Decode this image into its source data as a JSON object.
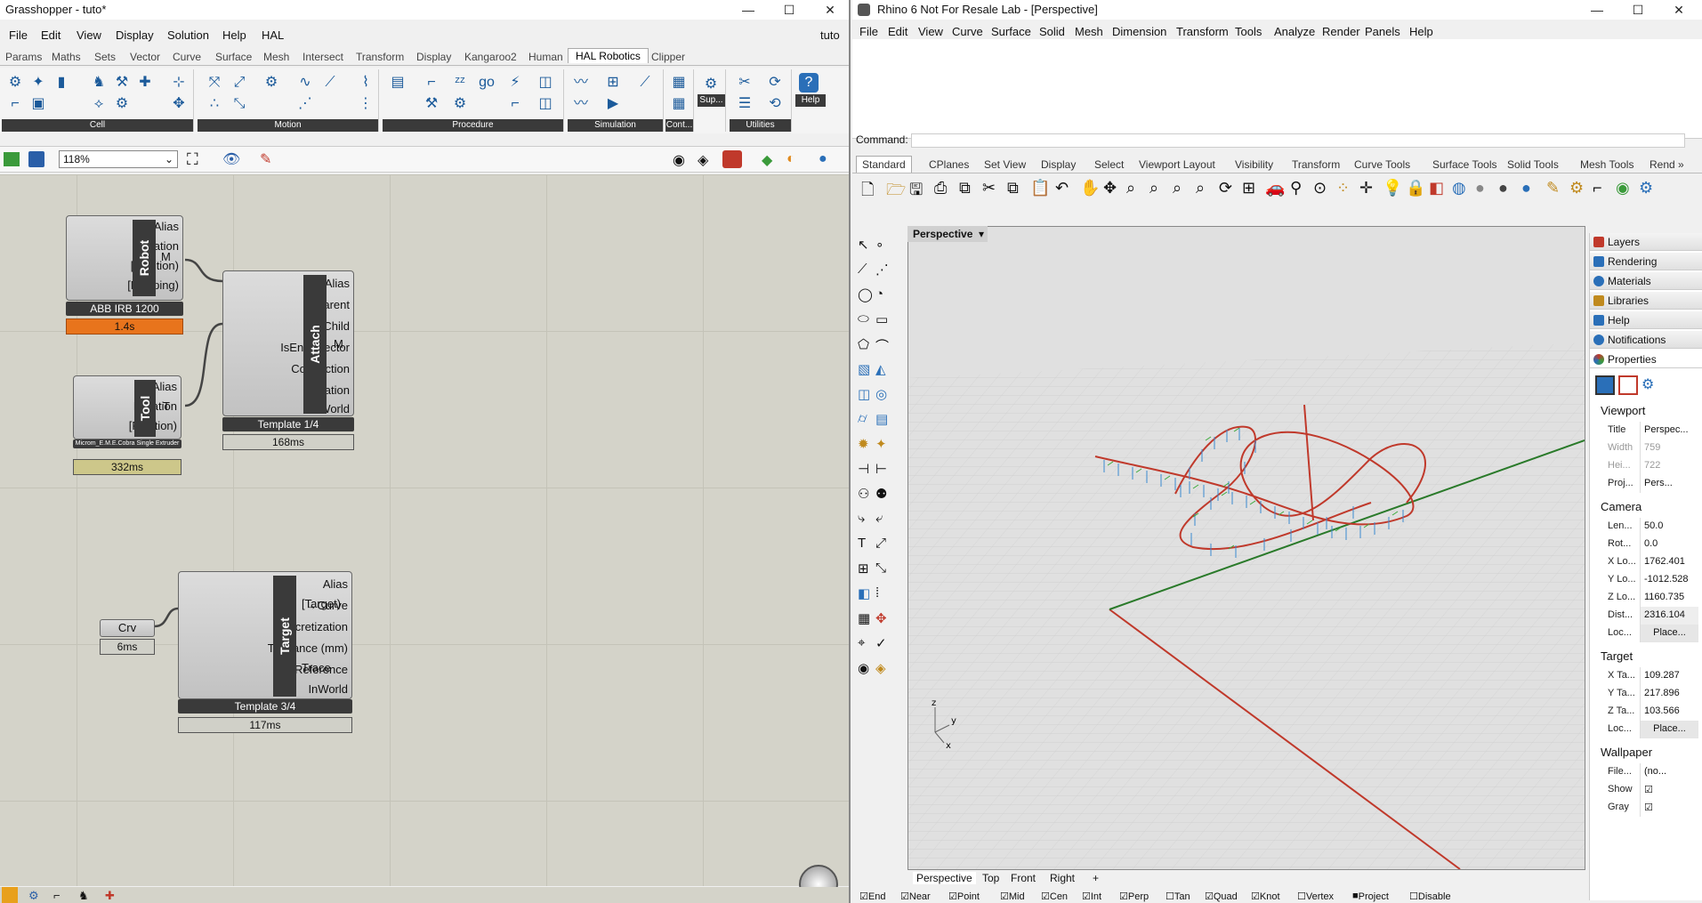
{
  "gh": {
    "title": "Grasshopper - tuto*",
    "doc_name": "tuto",
    "menu": [
      "File",
      "Edit",
      "View",
      "Display",
      "Solution",
      "Help",
      "HAL"
    ],
    "tabs": [
      "Params",
      "Maths",
      "Sets",
      "Vector",
      "Curve",
      "Surface",
      "Mesh",
      "Intersect",
      "Transform",
      "Display",
      "Kangaroo2",
      "Human",
      "HAL Robotics",
      "Clipper"
    ],
    "ribbon_groups": [
      "Cell",
      "Motion",
      "Procedure",
      "Simulation",
      "Cont...",
      "Sup...",
      "Utilities",
      "Help"
    ],
    "zoom": "118%",
    "robot": {
      "title": "Robot",
      "inputs": [
        "Alias",
        "Location",
        "[Position)",
        "[Mapping)"
      ],
      "output": "M",
      "nick": "ABB IRB 1200",
      "timer": "1.4s"
    },
    "tool": {
      "title": "Tool",
      "inputs": [
        "Alias",
        "Location",
        "[Position)"
      ],
      "output": "T",
      "nick": "Microm_E.M.E.Cobra Single Extruder",
      "timer": "332ms"
    },
    "attach": {
      "title": "Attach",
      "inputs": [
        "Alias",
        "→Parent",
        "→Child",
        "IsEndEffector",
        "Connection",
        "Location",
        "InWorld"
      ],
      "output": "M",
      "nick": "Template 1/4",
      "timer": "168ms"
    },
    "crv": {
      "label": "Crv",
      "timer": "6ms"
    },
    "target": {
      "title": "Target",
      "inputs": [
        "Alias",
        "→Curve",
        "Discretization",
        "Tolerance (mm)",
        "Reference",
        "InWorld"
      ],
      "outputs": [
        "[Target)",
        "Trace"
      ],
      "nick": "Template 3/4",
      "timer": "117ms"
    }
  },
  "rh": {
    "title": "Rhino 6 Not For Resale Lab - [Perspective]",
    "menu": [
      "File",
      "Edit",
      "View",
      "Curve",
      "Surface",
      "Solid",
      "Mesh",
      "Dimension",
      "Transform",
      "Tools",
      "Analyze",
      "Render",
      "Panels",
      "Help"
    ],
    "command_label": "Command:",
    "tabs": [
      "Standard",
      "CPlanes",
      "Set View",
      "Display",
      "Select",
      "Viewport Layout",
      "Visibility",
      "Transform",
      "Curve Tools",
      "Surface Tools",
      "Solid Tools",
      "Mesh Tools",
      "Rend »"
    ],
    "viewport_label": "Perspective",
    "bottom_tabs": [
      "Perspective",
      "Top",
      "Front",
      "Right"
    ],
    "panels": [
      "Layers",
      "Rendering",
      "Materials",
      "Libraries",
      "Help",
      "Notifications",
      "Properties"
    ],
    "properties": {
      "viewport_header": "Viewport",
      "viewport": [
        {
          "k": "Title",
          "v": "Perspec..."
        },
        {
          "k": "Width",
          "v": "759"
        },
        {
          "k": "Hei...",
          "v": "722"
        },
        {
          "k": "Proj...",
          "v": "Pers..."
        }
      ],
      "camera_header": "Camera",
      "camera": [
        {
          "k": "Len...",
          "v": "50.0"
        },
        {
          "k": "Rot...",
          "v": "0.0"
        },
        {
          "k": "X Lo...",
          "v": "1762.401"
        },
        {
          "k": "Y Lo...",
          "v": "-1012.528"
        },
        {
          "k": "Z Lo...",
          "v": "1160.735"
        },
        {
          "k": "Dist...",
          "v": "2316.104"
        },
        {
          "k": "Loc...",
          "v": "Place..."
        }
      ],
      "target_header": "Target",
      "target": [
        {
          "k": "X Ta...",
          "v": "109.287"
        },
        {
          "k": "Y Ta...",
          "v": "217.896"
        },
        {
          "k": "Z Ta...",
          "v": "103.566"
        },
        {
          "k": "Loc...",
          "v": "Place..."
        }
      ],
      "wallpaper_header": "Wallpaper",
      "wallpaper": [
        {
          "k": "File...",
          "v": "(no..."
        },
        {
          "k": "Show",
          "v": "☑"
        },
        {
          "k": "Gray",
          "v": "☑"
        }
      ]
    },
    "snaps": [
      "End",
      "Near",
      "Point",
      "Mid",
      "Cen",
      "Int",
      "Perp",
      "Tan",
      "Quad",
      "Knot",
      "Vertex",
      "Project",
      "Disable"
    ]
  }
}
